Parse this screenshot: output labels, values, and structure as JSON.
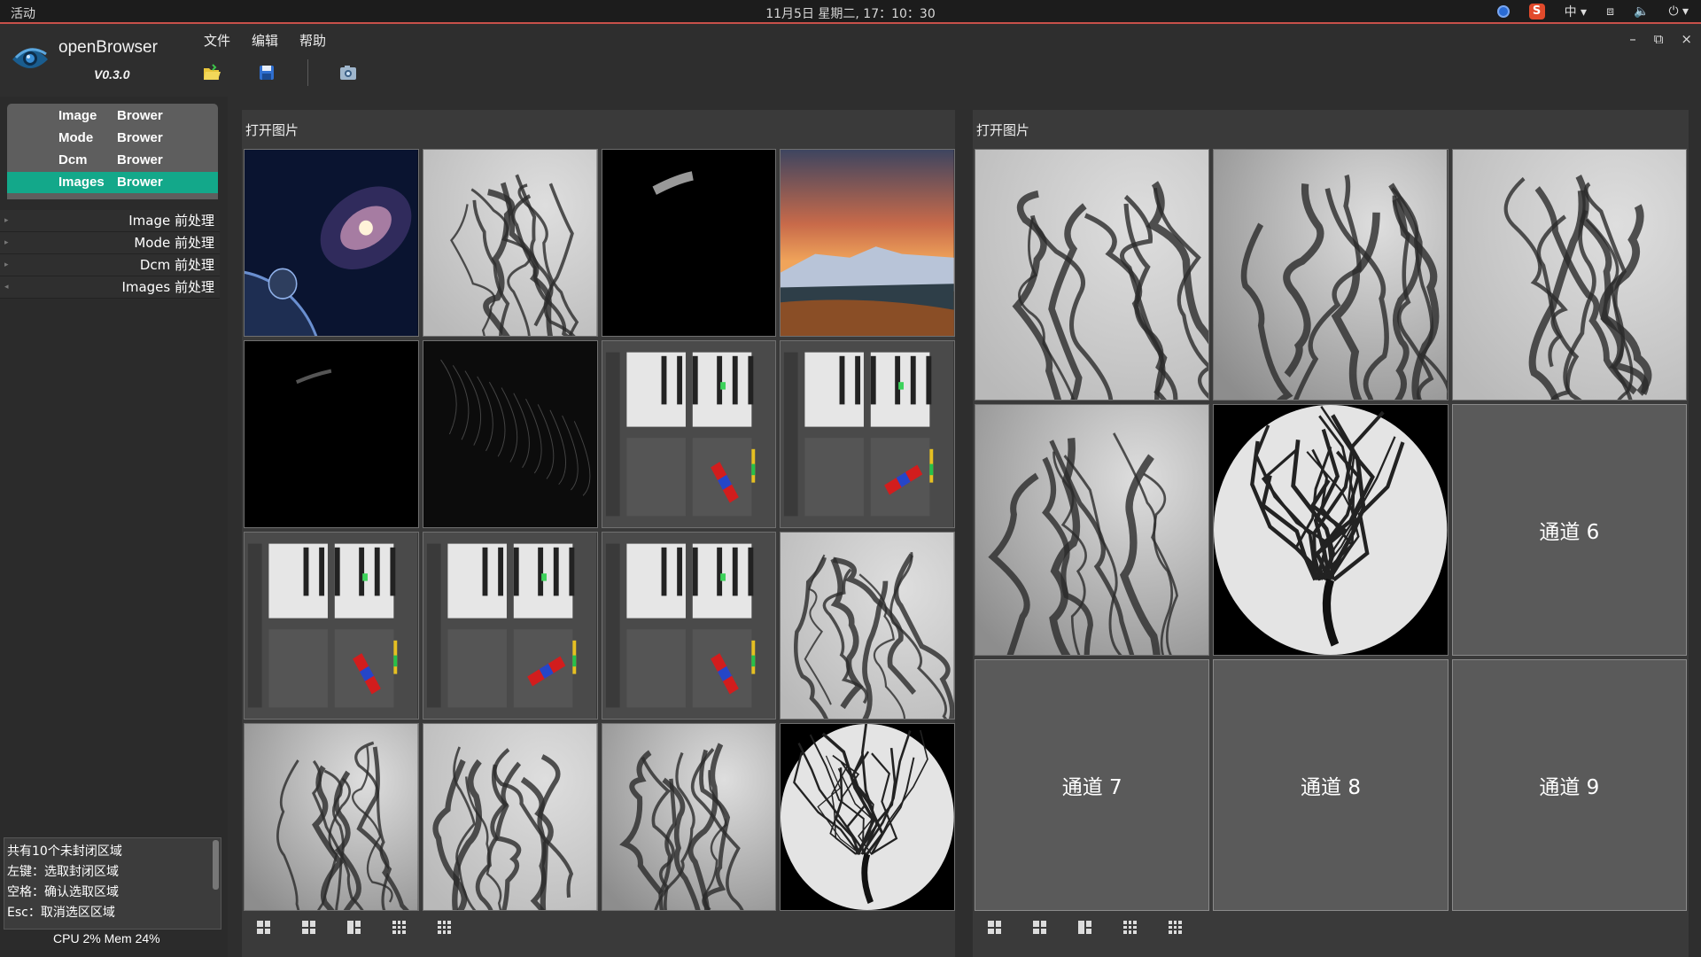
{
  "system": {
    "activities": "活动",
    "clock": "11月5日 星期二, 17：10：30",
    "input_method": "中",
    "sogou": "S"
  },
  "app": {
    "name": "openBrowser",
    "version": "V0.3.0",
    "menu": [
      "文件",
      "编辑",
      "帮助"
    ],
    "window_controls": [
      "–",
      "⧉",
      "×"
    ]
  },
  "sidebar": {
    "modes": [
      {
        "a": "Image",
        "b": "Brower",
        "active": false
      },
      {
        "a": "Mode",
        "b": "Brower",
        "active": false
      },
      {
        "a": "Dcm",
        "b": "Brower",
        "active": false
      },
      {
        "a": "Images",
        "b": "Brower",
        "active": true
      }
    ],
    "preprocess": [
      "Image 前处理",
      "Mode 前处理",
      "Dcm 前处理",
      "Images 前处理"
    ],
    "log": [
      "共有10个未封闭区域",
      "左键：选取封闭区域",
      "空格：确认选取区域",
      "Esc：取消选区区域"
    ],
    "status": "CPU 2%  Mem 24%"
  },
  "left_panel": {
    "title": "打开图片",
    "thumbs": [
      "galaxy",
      "angio",
      "black-vessel",
      "mountain",
      "black-vessel-small",
      "edge-noise",
      "ui-shot-a",
      "ui-shot-b",
      "ui-shot-c",
      "ui-shot-d",
      "ui-shot-e",
      "angio",
      "angio-b",
      "angio-c",
      "angio-d",
      "cerebral"
    ]
  },
  "right_panel": {
    "title": "打开图片",
    "cells": [
      {
        "kind": "angio"
      },
      {
        "kind": "angio-b"
      },
      {
        "kind": "angio-c"
      },
      {
        "kind": "angio-d"
      },
      {
        "kind": "cerebral"
      },
      {
        "kind": "empty",
        "label": "通道 6"
      },
      {
        "kind": "empty",
        "label": "通道 7"
      },
      {
        "kind": "empty",
        "label": "通道 8"
      },
      {
        "kind": "empty",
        "label": "通道 9"
      }
    ]
  },
  "colors": {
    "accent": "#13a88a",
    "titlebar_line": "#c8514a",
    "panel_bg": "#3a3a3a"
  }
}
